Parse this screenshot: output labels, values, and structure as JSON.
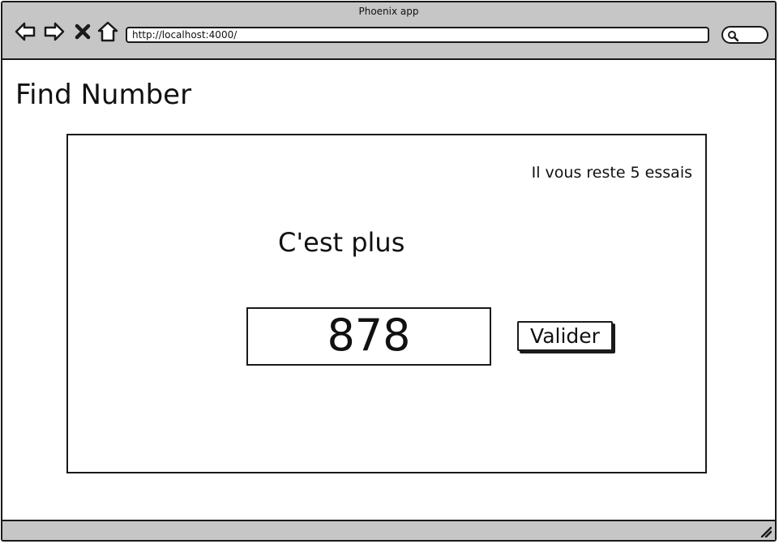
{
  "window": {
    "title": "Phoenix app",
    "url": "http://localhost:4000/"
  },
  "nav_icons": [
    "back-arrow-icon",
    "forward-arrow-icon",
    "close-icon",
    "home-icon",
    "search-icon"
  ],
  "page": {
    "title": "Find Number"
  },
  "game": {
    "tries_text": "Il vous reste 5 essais",
    "hint": "C'est plus",
    "guess_value": "878",
    "submit_label": "Valider"
  },
  "colors": {
    "chrome": "#c6c6c6",
    "ink": "#1a1a1a",
    "background": "#ffffff"
  }
}
